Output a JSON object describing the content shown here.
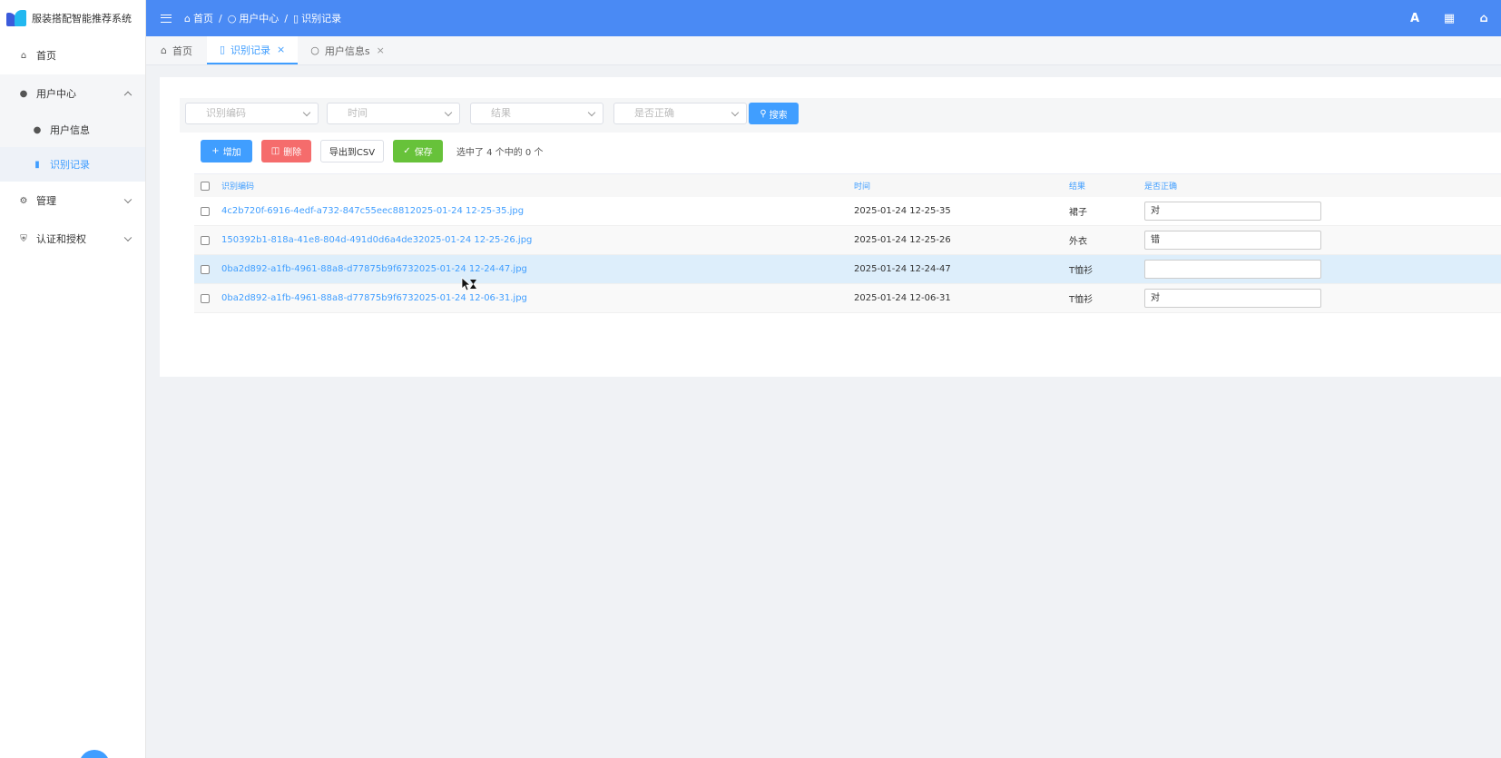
{
  "app": {
    "title": "服装搭配智能推荐系统"
  },
  "sidebar": {
    "items": [
      {
        "label": "首页",
        "icon": "home-icon"
      },
      {
        "label": "用户中心",
        "icon": "user-icon"
      },
      {
        "label": "用户信息",
        "icon": "user-icon"
      },
      {
        "label": "识别记录",
        "icon": "bookmark-icon"
      },
      {
        "label": "管理",
        "icon": "gear-icon"
      },
      {
        "label": "认证和授权",
        "icon": "shield-icon"
      }
    ]
  },
  "topbar": {
    "breadcrumb": [
      "首页",
      "用户中心",
      "识别记录"
    ],
    "icons": [
      "font-icon",
      "fullscreen-icon",
      "home-icon"
    ]
  },
  "tabs": [
    {
      "label": "首页",
      "icon": "home-icon"
    },
    {
      "label": "识别记录",
      "icon": "bookmark-icon"
    },
    {
      "label": "用户信息s",
      "icon": "user-icon"
    }
  ],
  "filters": {
    "code_placeholder": "识别编码",
    "time_placeholder": "时间",
    "result_placeholder": "结果",
    "correct_placeholder": "是否正确",
    "search_label": "搜索"
  },
  "toolbar": {
    "add_label": "增加",
    "delete_label": "删除",
    "export_label": "导出到CSV",
    "save_label": "保存",
    "selection_info": "选中了 4 个中的 0 个"
  },
  "table": {
    "columns": [
      "识别编码",
      "时间",
      "结果",
      "是否正确"
    ],
    "rows": [
      {
        "code": "4c2b720f-6916-4edf-a732-847c55eec8812025-01-24 12-25-35.jpg",
        "time": "2025-01-24 12-25-35",
        "result": "裙子",
        "correct": "对"
      },
      {
        "code": "150392b1-818a-41e8-804d-491d0d6a4de32025-01-24 12-25-26.jpg",
        "time": "2025-01-24 12-25-26",
        "result": "外衣",
        "correct": "错"
      },
      {
        "code": "0ba2d892-a1fb-4961-88a8-d77875b9f6732025-01-24 12-24-47.jpg",
        "time": "2025-01-24 12-24-47",
        "result": "T恤衫",
        "correct": ""
      },
      {
        "code": "0ba2d892-a1fb-4961-88a8-d77875b9f6732025-01-24 12-06-31.jpg",
        "time": "2025-01-24 12-06-31",
        "result": "T恤衫",
        "correct": "对"
      }
    ]
  },
  "colors": {
    "primary": "#409eff",
    "topbar": "#4a8af4",
    "danger": "#f56c6c",
    "success": "#67c23a"
  }
}
